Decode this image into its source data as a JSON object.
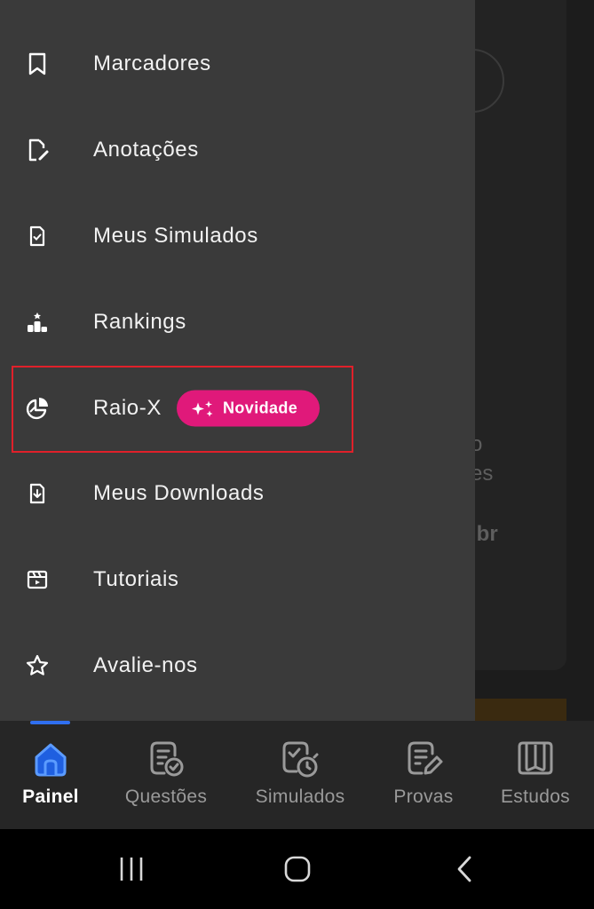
{
  "background": {
    "text_line_1": "o",
    "text_line_2": "es",
    "text_line_3": ".br"
  },
  "drawer": {
    "items": [
      {
        "label": "Marcadores",
        "icon": "bookmark-icon"
      },
      {
        "label": "Anotações",
        "icon": "note-edit-icon"
      },
      {
        "label": "Meus Simulados",
        "icon": "document-check-icon"
      },
      {
        "label": "Rankings",
        "icon": "podium-icon"
      },
      {
        "label": "Raio-X",
        "icon": "pie-chart-icon",
        "badge": "Novidade"
      },
      {
        "label": "Meus Downloads",
        "icon": "download-file-icon"
      },
      {
        "label": "Tutoriais",
        "icon": "video-clapper-icon"
      },
      {
        "label": "Avalie-nos",
        "icon": "star-icon"
      }
    ],
    "badge_color": "#e0197a",
    "highlight_color": "#e0202a"
  },
  "bottom_nav": {
    "items": [
      {
        "label": "Painel",
        "icon": "home-icon",
        "active": true
      },
      {
        "label": "Questões",
        "icon": "questions-icon",
        "active": false
      },
      {
        "label": "Simulados",
        "icon": "timer-check-icon",
        "active": false
      },
      {
        "label": "Provas",
        "icon": "exam-edit-icon",
        "active": false
      },
      {
        "label": "Estudos",
        "icon": "book-icon",
        "active": false
      }
    ],
    "accent": "#2f6ff0"
  },
  "system_bar": {
    "buttons": [
      "recent-apps-icon",
      "home-circle-icon",
      "back-icon"
    ]
  }
}
